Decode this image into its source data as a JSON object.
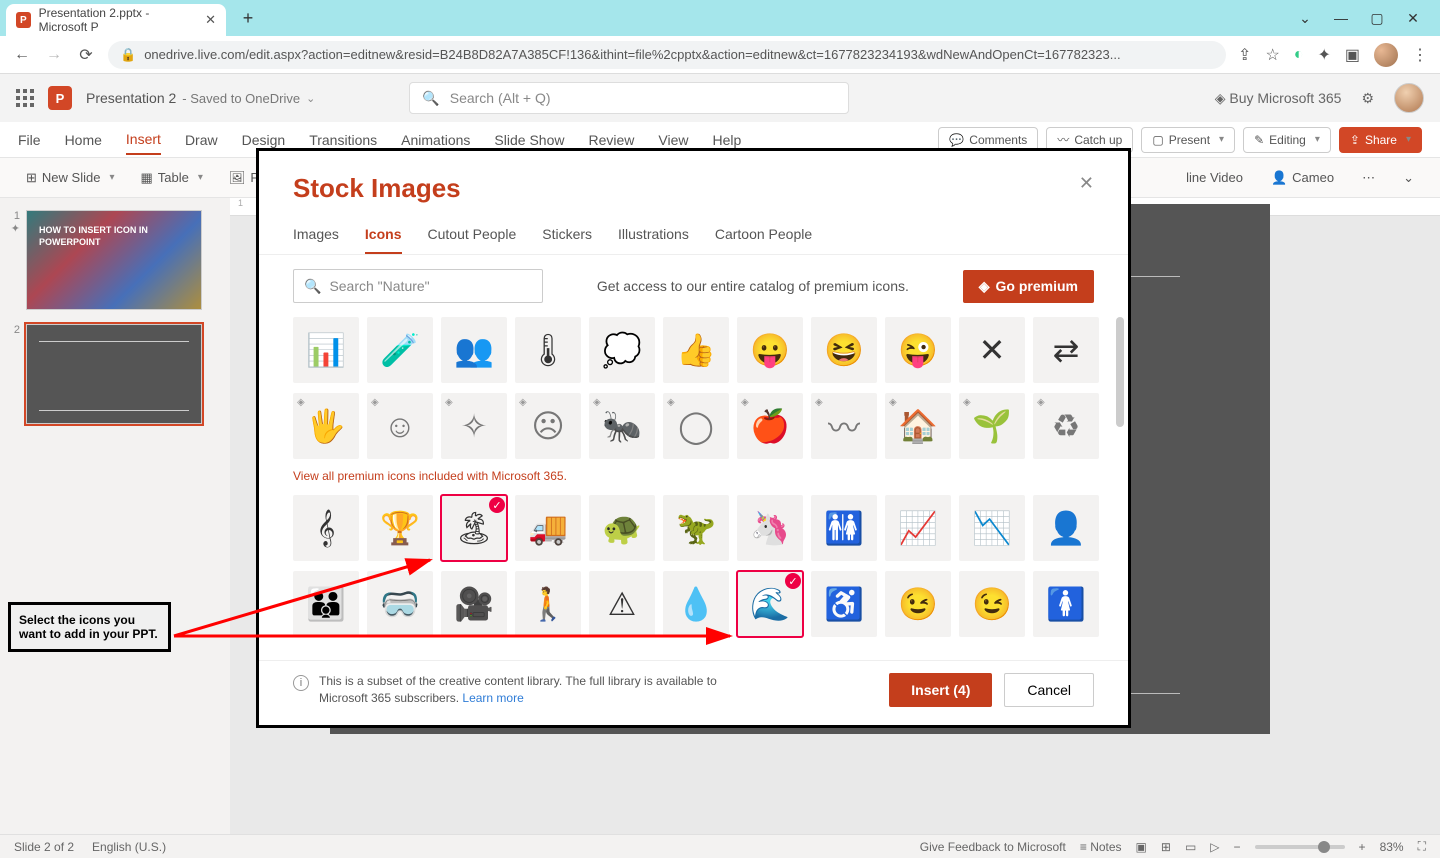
{
  "browser": {
    "tab_title": "Presentation 2.pptx - Microsoft P",
    "url": "onedrive.live.com/edit.aspx?action=editnew&resid=B24B8D82A7A385CF!136&ithint=file%2cpptx&action=editnew&ct=1677823234193&wdNewAndOpenCt=167782323..."
  },
  "app": {
    "doc_name": "Presentation 2",
    "saved_status": " - Saved to OneDrive",
    "search_placeholder": "Search (Alt + Q)",
    "buy_label": "Buy Microsoft 365"
  },
  "ribbon": {
    "tabs": [
      "File",
      "Home",
      "Insert",
      "Draw",
      "Design",
      "Transitions",
      "Animations",
      "Slide Show",
      "Review",
      "View",
      "Help"
    ],
    "active_tab": "Insert",
    "right": {
      "comments": "Comments",
      "catchup": "Catch up",
      "present": "Present",
      "editing": "Editing",
      "share": "Share"
    },
    "tools": {
      "newslide": "New Slide",
      "table": "Table",
      "pictures": "Pic",
      "video": "line Video",
      "cameo": "Cameo"
    }
  },
  "thumb1_text": "HOW TO INSERT ICON IN POWERPOINT",
  "callout_text": "Select the icons you want to add in your PPT.",
  "modal": {
    "title": "Stock Images",
    "tabs": [
      "Images",
      "Icons",
      "Cutout People",
      "Stickers",
      "Illustrations",
      "Cartoon People"
    ],
    "active_tab": "Icons",
    "search_placeholder": "Search \"Nature\"",
    "promo_text": "Get access to our entire catalog of premium icons.",
    "premium_btn": "Go premium",
    "link_text": "View all premium icons included with Microsoft 365.",
    "info_text_1": "This is a subset of the creative content library. The full library is available to Microsoft 365 subscribers. ",
    "info_link": "Learn more",
    "insert_btn": "Insert (4)",
    "cancel_btn": "Cancel",
    "row1": [
      "presentation",
      "test-tubes",
      "audience",
      "thermometer",
      "thought-cloud",
      "thumbs-up",
      "tongue-face",
      "laughing-face",
      "wink-face",
      "tools-cross",
      "swap-arrows"
    ],
    "row2_premium": [
      "hand-fish",
      "smiley",
      "compress",
      "sad-face",
      "bug",
      "aperture",
      "apple",
      "zigzag",
      "house-chart",
      "sprout",
      "recycle"
    ],
    "row3": [
      "treble-clef",
      "trophy",
      "palm-island",
      "truck",
      "turtle",
      "dinosaur",
      "unicorn",
      "people-access",
      "line-chart",
      "trend-chart",
      "person"
    ],
    "row4": [
      "group",
      "vr-headset",
      "camera",
      "walking",
      "warning",
      "droplet",
      "wave",
      "wheelchair",
      "wink-solid",
      "wink-outline",
      "woman"
    ],
    "glyphs": {
      "presentation": "📊",
      "test-tubes": "🧪",
      "audience": "👥",
      "thermometer": "🌡",
      "thought-cloud": "💭",
      "thumbs-up": "👍",
      "tongue-face": "😛",
      "laughing-face": "😆",
      "wink-face": "😜",
      "tools-cross": "✕",
      "swap-arrows": "⇄",
      "hand-fish": "🖐",
      "smiley": "☺",
      "compress": "✧",
      "sad-face": "☹",
      "bug": "🐜",
      "aperture": "◯",
      "apple": "🍎",
      "zigzag": "〰",
      "house-chart": "🏠",
      "sprout": "🌱",
      "recycle": "♻",
      "treble-clef": "𝄞",
      "trophy": "🏆",
      "palm-island": "🏝",
      "truck": "🚚",
      "turtle": "🐢",
      "dinosaur": "🦖",
      "unicorn": "🦄",
      "people-access": "🚻",
      "line-chart": "📈",
      "trend-chart": "📉",
      "person": "👤",
      "group": "👪",
      "vr-headset": "🥽",
      "camera": "🎥",
      "walking": "🚶",
      "warning": "⚠",
      "droplet": "💧",
      "wave": "🌊",
      "wheelchair": "♿",
      "wink-solid": "😉",
      "wink-outline": "😉",
      "woman": "🚺"
    },
    "selected": [
      "palm-island",
      "wave"
    ]
  },
  "status": {
    "slide_info": "Slide 2 of 2",
    "language": "English (U.S.)",
    "feedback": "Give Feedback to Microsoft",
    "notes": "Notes",
    "zoom": "83%"
  }
}
